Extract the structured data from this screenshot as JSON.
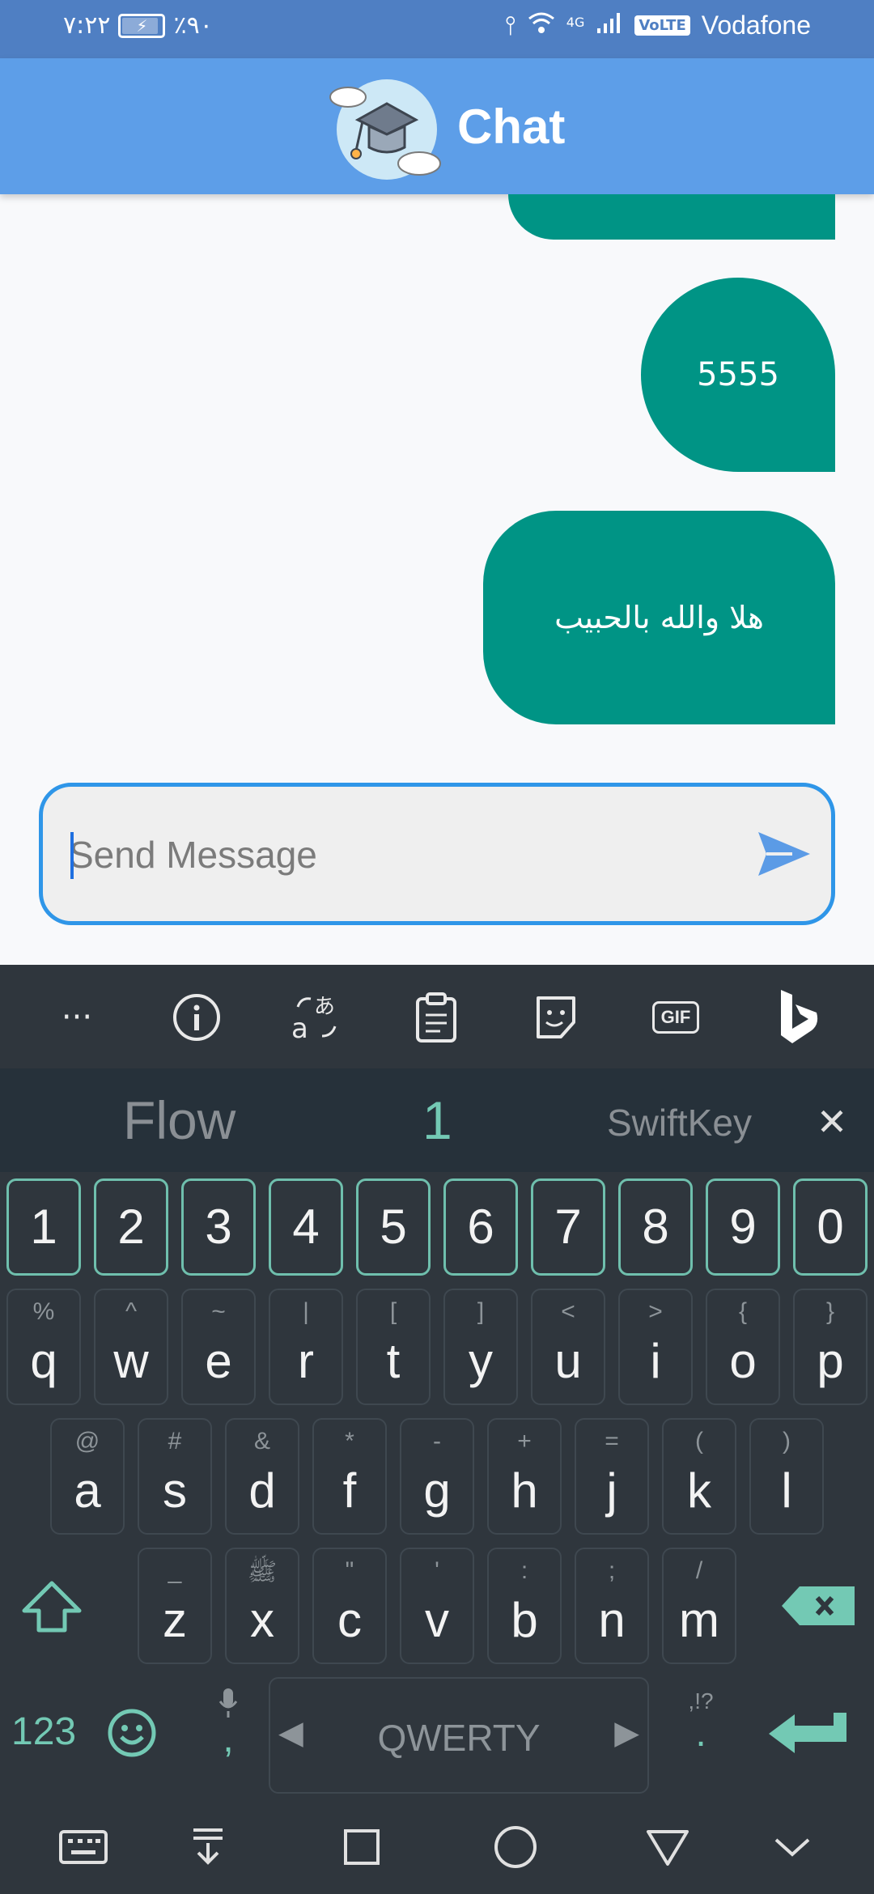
{
  "status_bar": {
    "time": "٧:٢٢",
    "battery_text": "٪٩٠",
    "network_gen": "4G",
    "volte": "VoLTE",
    "carrier": "Vodafone"
  },
  "app_bar": {
    "title": "Chat",
    "logo_icon": "graduation-cap-cloud-icon"
  },
  "messages": [
    {
      "text": "5555",
      "sender": "me"
    },
    {
      "text": "هلا والله بالحبيب",
      "sender": "me"
    }
  ],
  "composer": {
    "placeholder": "Send Message",
    "value": "",
    "send_icon": "send-icon"
  },
  "keyboard": {
    "toolbar": [
      "more-icon",
      "info-icon",
      "translate-icon",
      "clipboard-icon",
      "sticker-icon",
      "gif-icon",
      "bing-icon"
    ],
    "gif_label": "GIF",
    "suggestions": [
      "Flow",
      "1",
      "SwiftKey"
    ],
    "numbers": [
      "1",
      "2",
      "3",
      "4",
      "5",
      "6",
      "7",
      "8",
      "9",
      "0"
    ],
    "row1": [
      {
        "main": "q",
        "sub": "%"
      },
      {
        "main": "w",
        "sub": "^"
      },
      {
        "main": "e",
        "sub": "~"
      },
      {
        "main": "r",
        "sub": "|"
      },
      {
        "main": "t",
        "sub": "["
      },
      {
        "main": "y",
        "sub": "]"
      },
      {
        "main": "u",
        "sub": "<"
      },
      {
        "main": "i",
        "sub": ">"
      },
      {
        "main": "o",
        "sub": "{"
      },
      {
        "main": "p",
        "sub": "}"
      }
    ],
    "row2": [
      {
        "main": "a",
        "sub": "@"
      },
      {
        "main": "s",
        "sub": "#"
      },
      {
        "main": "d",
        "sub": "&"
      },
      {
        "main": "f",
        "sub": "*"
      },
      {
        "main": "g",
        "sub": "-"
      },
      {
        "main": "h",
        "sub": "+"
      },
      {
        "main": "j",
        "sub": "="
      },
      {
        "main": "k",
        "sub": "("
      },
      {
        "main": "l",
        "sub": ")"
      }
    ],
    "row3": [
      {
        "main": "z",
        "sub": "_"
      },
      {
        "main": "x",
        "sub": "ﷺ"
      },
      {
        "main": "c",
        "sub": "\""
      },
      {
        "main": "v",
        "sub": "'"
      },
      {
        "main": "b",
        "sub": ":"
      },
      {
        "main": "n",
        "sub": ";"
      },
      {
        "main": "m",
        "sub": "/"
      }
    ],
    "numeric_toggle": "123",
    "comma": ",",
    "space_label": "QWERTY",
    "period_key_sub": ",!?",
    "period": "."
  },
  "nav_bar": [
    "keyboard-icon",
    "hide-keyboard-icon",
    "recents-icon",
    "home-icon",
    "back-icon",
    "collapse-icon"
  ],
  "colors": {
    "status_bar": "#4f7fc3",
    "app_bar": "#5d9ee8",
    "bubble": "#009485",
    "input_border": "#2f96e8",
    "keyboard_bg": "#2f363d",
    "accent": "#73c9b4"
  }
}
